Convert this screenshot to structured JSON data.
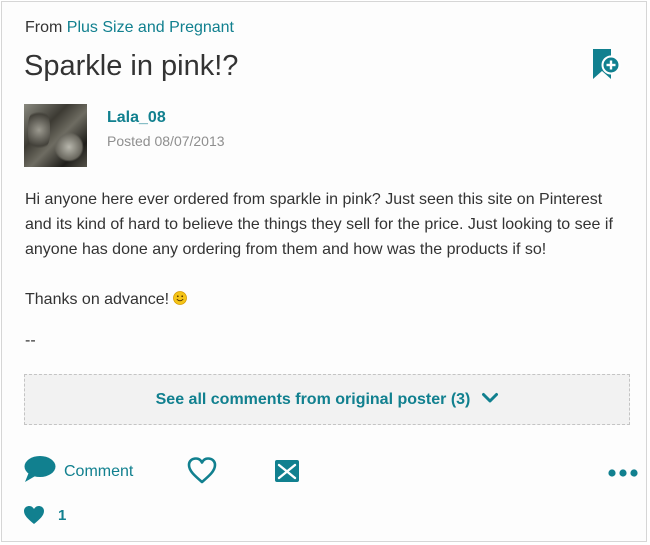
{
  "breadcrumb": {
    "prefix": "From",
    "group_link": "Plus Size and Pregnant"
  },
  "post": {
    "title": "Sparkle in pink!?",
    "author": "Lala_08",
    "posted": "Posted 08/07/2013",
    "body_paragraphs": [
      "Hi anyone here ever ordered from sparkle in pink? Just seen this site on Pinterest and its kind of hard to believe the things they sell for the price. Just looking to see if anyone has done any ordering from them and how was the products if so!",
      "Thanks on advance!"
    ],
    "signature": "--"
  },
  "see_all": {
    "label": "See all comments from original poster (3)"
  },
  "actions": {
    "comment_label": "Comment",
    "like_count": "1"
  },
  "colors": {
    "accent": "#11808f",
    "text": "#333333",
    "muted": "#8f8f8f",
    "panel_bg": "#f2f2f2"
  },
  "icons": {
    "bookmark": "bookmark-add-icon",
    "comment": "speech-bubble-icon",
    "like": "heart-outline-icon",
    "share": "envelope-icon",
    "more": "ellipsis-icon",
    "likes": "heart-filled-icon",
    "expand": "chevron-down-icon",
    "emoji": "smiley-icon"
  }
}
